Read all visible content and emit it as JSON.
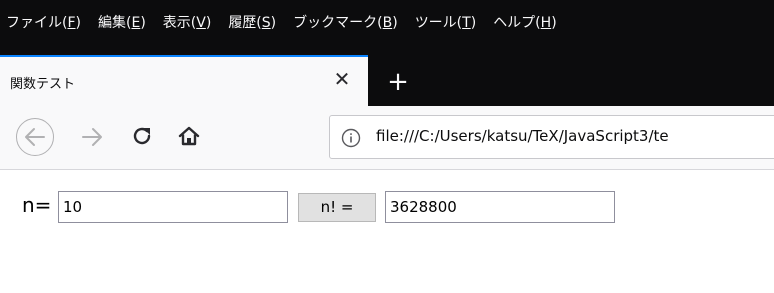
{
  "menubar": {
    "items": [
      {
        "label": "ファイル(",
        "mnemonic": "F",
        "end": ")"
      },
      {
        "label": "編集(",
        "mnemonic": "E",
        "end": ")"
      },
      {
        "label": "表示(",
        "mnemonic": "V",
        "end": ")"
      },
      {
        "label": "履歴(",
        "mnemonic": "S",
        "end": ")"
      },
      {
        "label": "ブックマーク(",
        "mnemonic": "B",
        "end": ")"
      },
      {
        "label": "ツール(",
        "mnemonic": "T",
        "end": ")"
      },
      {
        "label": "ヘルプ(",
        "mnemonic": "H",
        "end": ")"
      }
    ]
  },
  "tab": {
    "title": "関数テスト",
    "close_glyph": "✕"
  },
  "new_tab_glyph": "+",
  "urlbar": {
    "url": "file:///C:/Users/katsu/TeX/JavaScript3/te"
  },
  "form": {
    "n_label": "n=",
    "n_value": "10",
    "button_label": "n! =",
    "result_value": "3628800"
  },
  "colors": {
    "menubar_bg": "#0c0c0d",
    "tab_accent": "#0a84ff",
    "toolbar_bg": "#f9f9fa"
  }
}
